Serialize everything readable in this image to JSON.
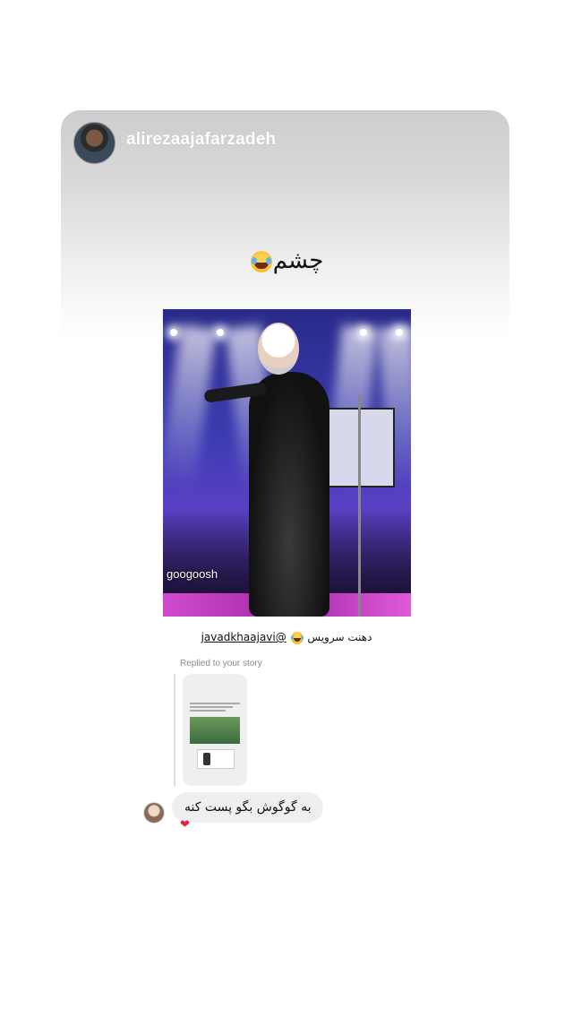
{
  "story": {
    "username": "alirezaajafarzadeh",
    "caption_text": "چشم",
    "caption_emoji": "face-with-tears-of-joy",
    "photo_watermark": "googoosh"
  },
  "repost": {
    "caption_text": "دهنت سرویس",
    "caption_emoji": "face-with-tears-of-joy",
    "mention": "@javadkhaajavi"
  },
  "reply": {
    "label": "Replied to your story",
    "message": "به گوگوش بگو پست کنه",
    "reaction": "❤"
  },
  "colors": {
    "reaction_heart": "#e0263d",
    "bubble": "#efefef"
  }
}
